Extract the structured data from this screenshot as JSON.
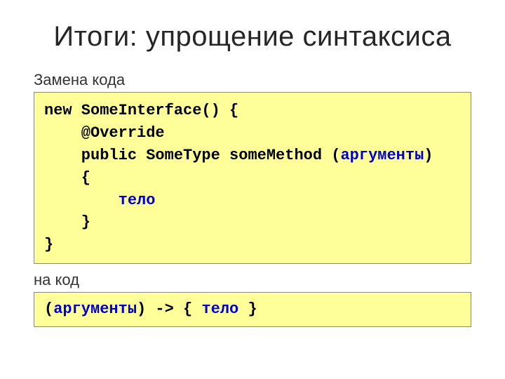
{
  "title": "Итоги: упрощение синтаксиса",
  "label_before": "Замена кода",
  "label_after": "на код",
  "code1": {
    "l1a": "new SomeInterface() {",
    "l2a": "    @Override",
    "l3a": "    public SomeType someMethod (",
    "l3b": "аргументы",
    "l3c": ")",
    "l4a": "    {",
    "l5a": "        ",
    "l5b": "тело",
    "l6a": "    }",
    "l7a": "}"
  },
  "code2": {
    "a": "(",
    "b": "аргументы",
    "c": ") -> { ",
    "d": "тело",
    "e": " }"
  }
}
